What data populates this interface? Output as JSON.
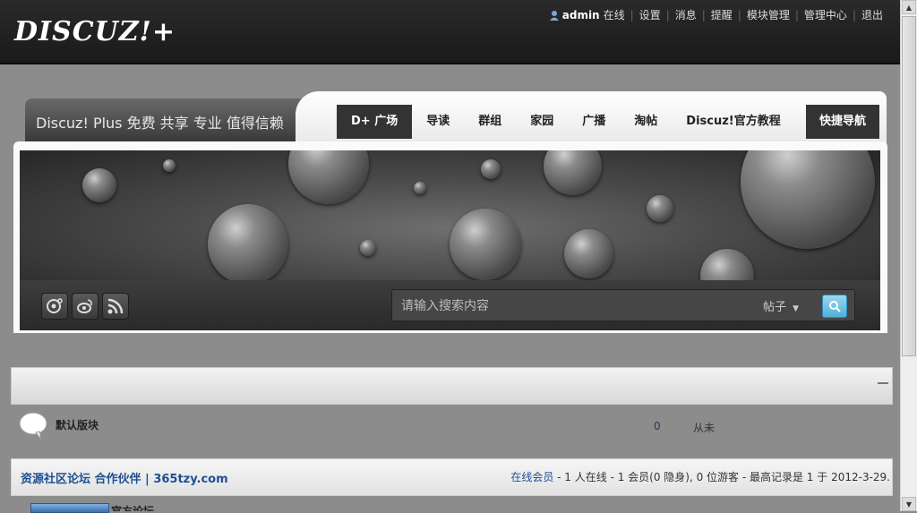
{
  "logo": "DISCUZ!+",
  "user": {
    "name": "admin",
    "status": "在线",
    "links": [
      "设置",
      "消息",
      "提醒",
      "模块管理",
      "管理中心",
      "退出"
    ]
  },
  "header": {
    "slogan": "Discuz! Plus 免费 共享 专业 值得信赖",
    "nav": [
      "D+ 广场",
      "导读",
      "群组",
      "家园",
      "广播",
      "淘帖",
      "Discuz!官方教程"
    ],
    "active_nav": "D+ 广场",
    "quick_nav": "快捷导航"
  },
  "search": {
    "placeholder": "请输入搜索内容",
    "type": "帖子"
  },
  "forum": {
    "name": "默认版块",
    "count": "0",
    "last_post": "从未"
  },
  "partners": {
    "title": "资源社区论坛 合作伙伴 | 365tzy.com",
    "online_label": "在线会员",
    "online_text": " - 1 人在线 - 1 会员(0 隐身), 0 位游客 - 最高记录是 1 于 2012-3-29."
  },
  "official": {
    "name": "官方论坛"
  },
  "colors": {
    "accent": "#1e4f92",
    "topbar": "#1a1a1a",
    "search_button": "#4fb0d9"
  },
  "icons": [
    "user-icon",
    "qq-icon",
    "weibo-icon",
    "rss-icon",
    "search-icon",
    "chevron-down-icon",
    "speech-bubble-icon"
  ]
}
